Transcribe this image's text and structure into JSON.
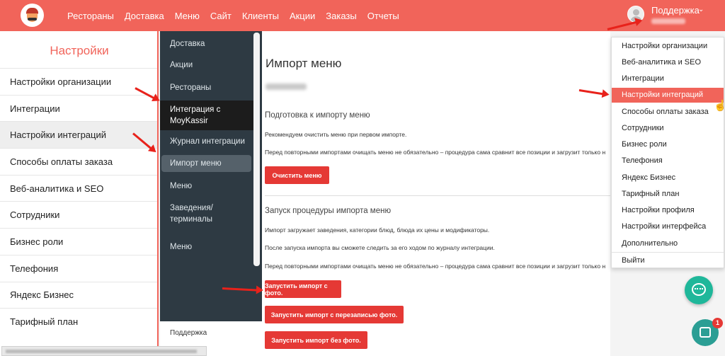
{
  "nav": {
    "items": [
      "Рестораны",
      "Доставка",
      "Меню",
      "Сайт",
      "Клиенты",
      "Акции",
      "Заказы",
      "Отчеты"
    ]
  },
  "user": {
    "name": "Поддержка",
    "chevron": "⌄"
  },
  "settings": {
    "title": "Настройки",
    "items": [
      "Настройки организации",
      "Интеграции",
      "Настройки интеграций",
      "Способы оплаты заказа",
      "Веб-аналитика и SEO",
      "Сотрудники",
      "Бизнес роли",
      "Телефония",
      "Яндекс Бизнес",
      "Тарифный план"
    ],
    "active_index": 2
  },
  "submenu": {
    "items": [
      "Доставка",
      "Акции",
      "Рестораны",
      "Интеграция с MoyKassir",
      "Журнал интеграции",
      "Импорт меню",
      "Меню",
      "Заведения/ терминалы",
      "Меню"
    ],
    "footer": "Поддержка"
  },
  "main": {
    "title": "Импорт меню",
    "section1": {
      "title": "Подготовка к импорту меню",
      "text1": "Рекомендуем очистить меню при первом импорте.",
      "text2": "Перед повторными импортами очищать меню не обязательно – процедура сама сравнит все позиции и загрузит только н",
      "button": "Очистить меню"
    },
    "section2": {
      "title": "Запуск процедуры импорта меню",
      "text1": "Импорт загружает заведения, категории блюд, блюда их цены и модификаторы.",
      "text2": "После запуска импорта вы сможете следить за его ходом по журналу интеграции.",
      "text3": "Перед повторными импортами очищать меню не обязательно – процедура сама сравнит все позиции и загрузит только н",
      "buttons": [
        "Запустить импорт с фото.",
        "Запустить импорт с перезаписью фото.",
        "Запустить импорт без фото."
      ]
    }
  },
  "dropdown": {
    "items": [
      "Настройки организации",
      "Веб-аналитика и SEO",
      "Интеграции",
      "Настройки интеграций",
      "Способы оплаты заказа",
      "Сотрудники",
      "Бизнес роли",
      "Телефония",
      "Яндекс Бизнес",
      "Тарифный план",
      "Настройки профиля",
      "Настройки интерфейса",
      "Дополнительно"
    ],
    "logout": "Выйти",
    "active_index": 3
  },
  "badges": {
    "intercom_count": "1"
  },
  "colors": {
    "brand": "#f1645a",
    "button": "#e53935",
    "sidebar_dark": "#2e3a43",
    "arrow": "#e8221b",
    "chat": "#1fb79a"
  },
  "icons": {
    "logo": "mascot-logo-icon",
    "avatar": "user-avatar-icon",
    "chat": "chat-bubble-icon",
    "intercom": "intercom-icon",
    "cursor": "hand-pointer-icon"
  }
}
